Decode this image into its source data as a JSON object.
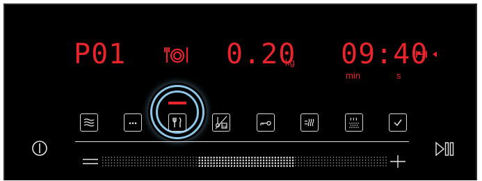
{
  "display": {
    "program": "P01",
    "weight_value": "0.20",
    "weight_unit": "kg",
    "time_value": "09:40",
    "time_min_label": "min",
    "time_s_label": "s",
    "active_marker_color": "#e8242c"
  },
  "buttons": [
    {
      "name": "heating-mode-button",
      "icon": "heat-waves-icon"
    },
    {
      "name": "more-options-button",
      "icon": "dots-icon"
    },
    {
      "name": "meal-program-button",
      "icon": "fork-knife-icon",
      "selected": true
    },
    {
      "name": "temperature-weight-button",
      "icon": "thermometer-weight-icon"
    },
    {
      "name": "child-lock-button",
      "icon": "key-icon"
    },
    {
      "name": "fast-preheat-button",
      "icon": "fast-heat-icon"
    },
    {
      "name": "steam-button",
      "icon": "steam-dots-icon"
    },
    {
      "name": "confirm-button",
      "icon": "checkmark-icon"
    }
  ],
  "colors": {
    "display_red": "#e8242c",
    "highlight_ring": "#8ec6e8",
    "panel_bg": "#000000",
    "icon_white": "#e6e6e6"
  }
}
